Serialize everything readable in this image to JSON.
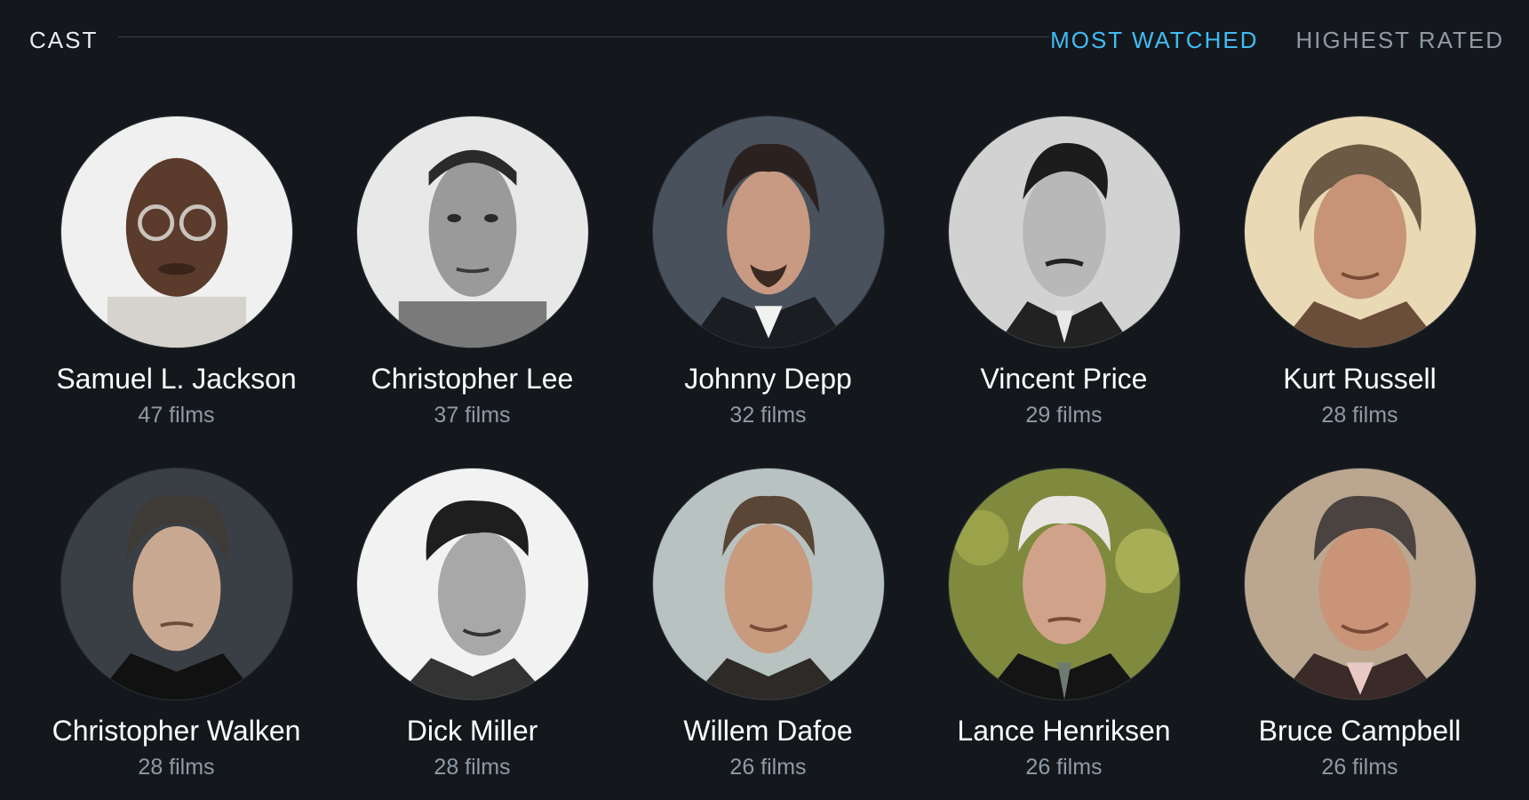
{
  "header": {
    "title": "CAST",
    "tabs": [
      {
        "label": "MOST WATCHED",
        "active": true
      },
      {
        "label": "HIGHEST RATED",
        "active": false
      }
    ]
  },
  "colors": {
    "background": "#14181d",
    "accent": "#40bcf4",
    "muted": "#8f9aa6"
  },
  "cast": [
    {
      "name": "Samuel L. Jackson",
      "count": "47 films"
    },
    {
      "name": "Christopher Lee",
      "count": "37 films"
    },
    {
      "name": "Johnny Depp",
      "count": "32 films"
    },
    {
      "name": "Vincent Price",
      "count": "29 films"
    },
    {
      "name": "Kurt Russell",
      "count": "28 films"
    },
    {
      "name": "Christopher Walken",
      "count": "28 films"
    },
    {
      "name": "Dick Miller",
      "count": "28 films"
    },
    {
      "name": "Willem Dafoe",
      "count": "26 films"
    },
    {
      "name": "Lance Henriksen",
      "count": "26 films"
    },
    {
      "name": "Bruce Campbell",
      "count": "26 films"
    }
  ]
}
